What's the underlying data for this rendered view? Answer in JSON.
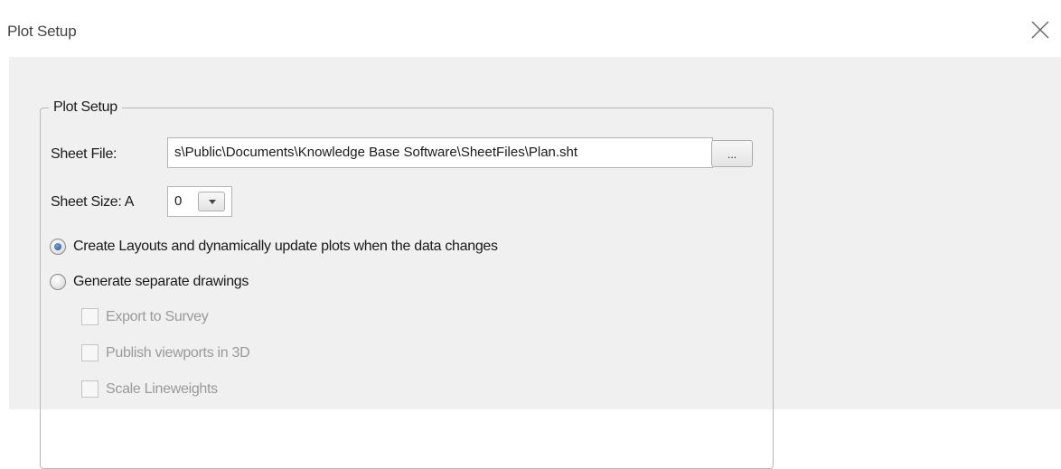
{
  "window": {
    "title": "Plot Setup",
    "close_icon": "close-icon"
  },
  "group": {
    "legend": "Plot Setup",
    "sheet_file_label": "Sheet File:",
    "sheet_file_value": "s\\Public\\Documents\\Knowledge Base Software\\SheetFiles\\Plan.sht",
    "browse_label": "...",
    "sheet_size_label": "Sheet Size: A",
    "sheet_size_value": "0",
    "options": [
      {
        "label": "Create Layouts and dynamically update plots when the data changes",
        "selected": true
      },
      {
        "label": "Generate separate drawings",
        "selected": false
      }
    ],
    "checkboxes": [
      {
        "label": "Export to Survey",
        "checked": false,
        "enabled": false
      },
      {
        "label": "Publish viewports in 3D",
        "checked": false,
        "enabled": false
      },
      {
        "label": "Scale Lineweights",
        "checked": false,
        "enabled": false
      }
    ]
  }
}
